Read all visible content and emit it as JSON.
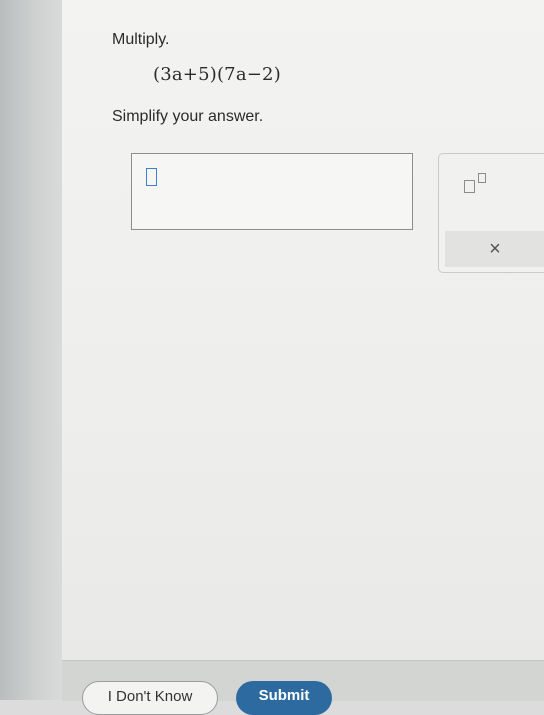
{
  "question": {
    "instruction": "Multiply.",
    "expression": "(3a+5)(7a−2)",
    "simplify_text": "Simplify your answer."
  },
  "answer": {
    "value": ""
  },
  "palette": {
    "exponent_icon": "exponent-template-icon",
    "clear_symbol": "×"
  },
  "footer": {
    "dont_know_label": "I Don't Know",
    "submit_label": "Submit"
  },
  "colors": {
    "submit_bg": "#2c6aa0",
    "cursor_outline": "#3f7fd0"
  }
}
